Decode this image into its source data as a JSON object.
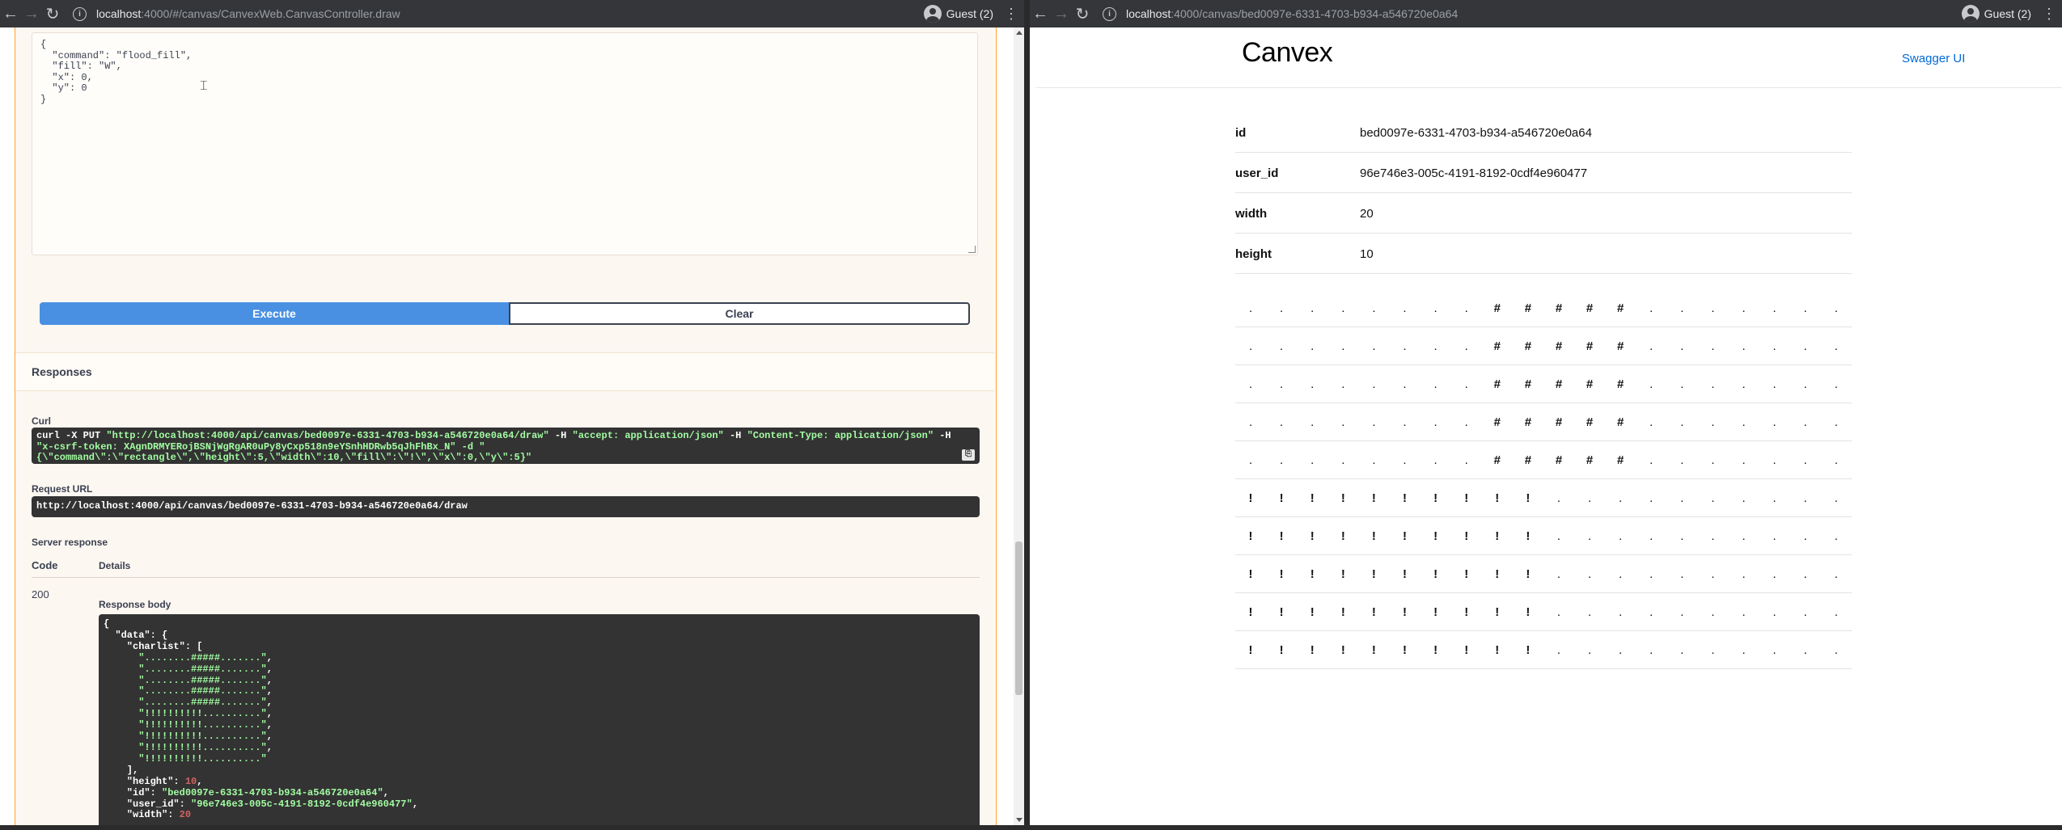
{
  "left_window": {
    "url_main": "localhost",
    "url_rest": ":4000/#/canvas/CanvexWeb.CanvasController.draw",
    "profile": "Guest (2)",
    "request_body_lines": [
      "{",
      "  \"command\": \"flood_fill\",",
      "  \"fill\": \"W\",",
      "  \"x\": 0,",
      "  \"y\": 0",
      "}"
    ],
    "execute_label": "Execute",
    "clear_label": "Clear",
    "responses_title": "Responses",
    "curl_label": "Curl",
    "curl_lines": [
      "curl -X PUT \"http://localhost:4000/api/canvas/bed0097e-6331-4703-b934-a546720e0a64/draw\" -H  \"accept: application/json\" -H  \"Content-Type: application/json\" -H",
      "\"x-csrf-token: XAgnDRMYERojBSNjWgRgAR0uPy8yCxp518n9eYSnhHDRwb5qJhFhBx_N\" -d \"",
      "{\\\"command\\\":\\\"rectangle\\\",\\\"height\\\":5,\\\"width\\\":10,\\\"fill\\\":\\\"!\\\",\\\"x\\\":0,\\\"y\\\":5}\""
    ],
    "request_url_label": "Request URL",
    "request_url": "http://localhost:4000/api/canvas/bed0097e-6331-4703-b934-a546720e0a64/draw",
    "server_response_label": "Server response",
    "code_header": "Code",
    "details_header": "Details",
    "response_code": "200",
    "response_body_label": "Response body",
    "response_body": {
      "open": "{",
      "data_open": "  \"data\": {",
      "charlist_open": "    \"charlist\": [",
      "charlist": [
        "........#####.......",
        "........#####.......",
        "........#####.......",
        "........#####.......",
        "........#####.......",
        "!!!!!!!!!!..........",
        "!!!!!!!!!!..........",
        "!!!!!!!!!!..........",
        "!!!!!!!!!!..........",
        "!!!!!!!!!!.........."
      ],
      "charlist_close": "    ],",
      "height_key": "    \"height\": ",
      "height_val": "10",
      "id_line_key": "    \"id\": ",
      "id_val": "\"bed0097e-6331-4703-b934-a546720e0a64\"",
      "user_id_key": "    \"user_id\": ",
      "user_id_val": "\"96e746e3-005c-4191-8192-0cdf4e960477\"",
      "width_key": "    \"width\": ",
      "width_val": "20"
    }
  },
  "right_window": {
    "url_main": "localhost",
    "url_rest": ":4000/canvas/bed0097e-6331-4703-b934-a546720e0a64",
    "profile": "Guest (2)",
    "logo": "Canvex",
    "swagger_link": "Swagger UI",
    "meta": [
      {
        "key": "id",
        "value": "bed0097e-6331-4703-b934-a546720e0a64"
      },
      {
        "key": "user_id",
        "value": "96e746e3-005c-4191-8192-0cdf4e960477"
      },
      {
        "key": "width",
        "value": "20"
      },
      {
        "key": "height",
        "value": "10"
      }
    ],
    "grid_rows": [
      "........#####.......",
      "........#####.......",
      "........#####.......",
      "........#####.......",
      "........#####.......",
      "!!!!!!!!!!..........",
      "!!!!!!!!!!..........",
      "!!!!!!!!!!..........",
      "!!!!!!!!!!..........",
      "!!!!!!!!!!.........."
    ]
  },
  "icons": {
    "back": "arrow-left-icon",
    "forward": "arrow-right-icon",
    "reload": "reload-icon",
    "info": "info-icon",
    "menu": "kebab-menu-icon",
    "copy": "copy-icon"
  }
}
